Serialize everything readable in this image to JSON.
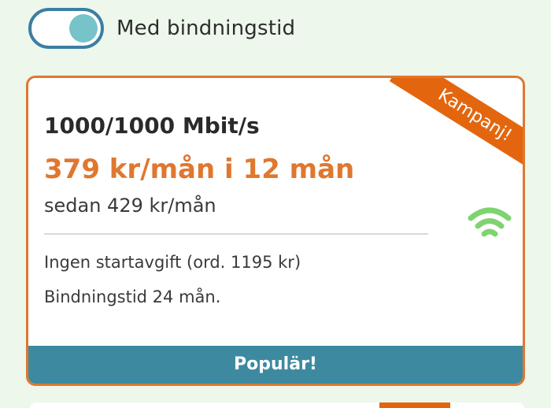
{
  "toggle": {
    "label": "Med bindningstid",
    "on": true
  },
  "card": {
    "title": "1000/1000 Mbit/s",
    "price": "379 kr/mån i 12 mån",
    "then_price": "sedan 429 kr/mån",
    "features": [
      "Ingen startavgift  (ord. 1195 kr)",
      "Bindningstid 24 mån."
    ],
    "ribbon": "Kampanj!",
    "footer": "Populär!",
    "icon": "wifi-icon"
  },
  "colors": {
    "accent": "#e0772f",
    "ribbon": "#e3660f",
    "footer": "#3d8aa0",
    "toggle_border": "#3c7ea2",
    "toggle_knob": "#76c3c9",
    "wifi": "#7ed46f",
    "background": "#edf7ec"
  }
}
